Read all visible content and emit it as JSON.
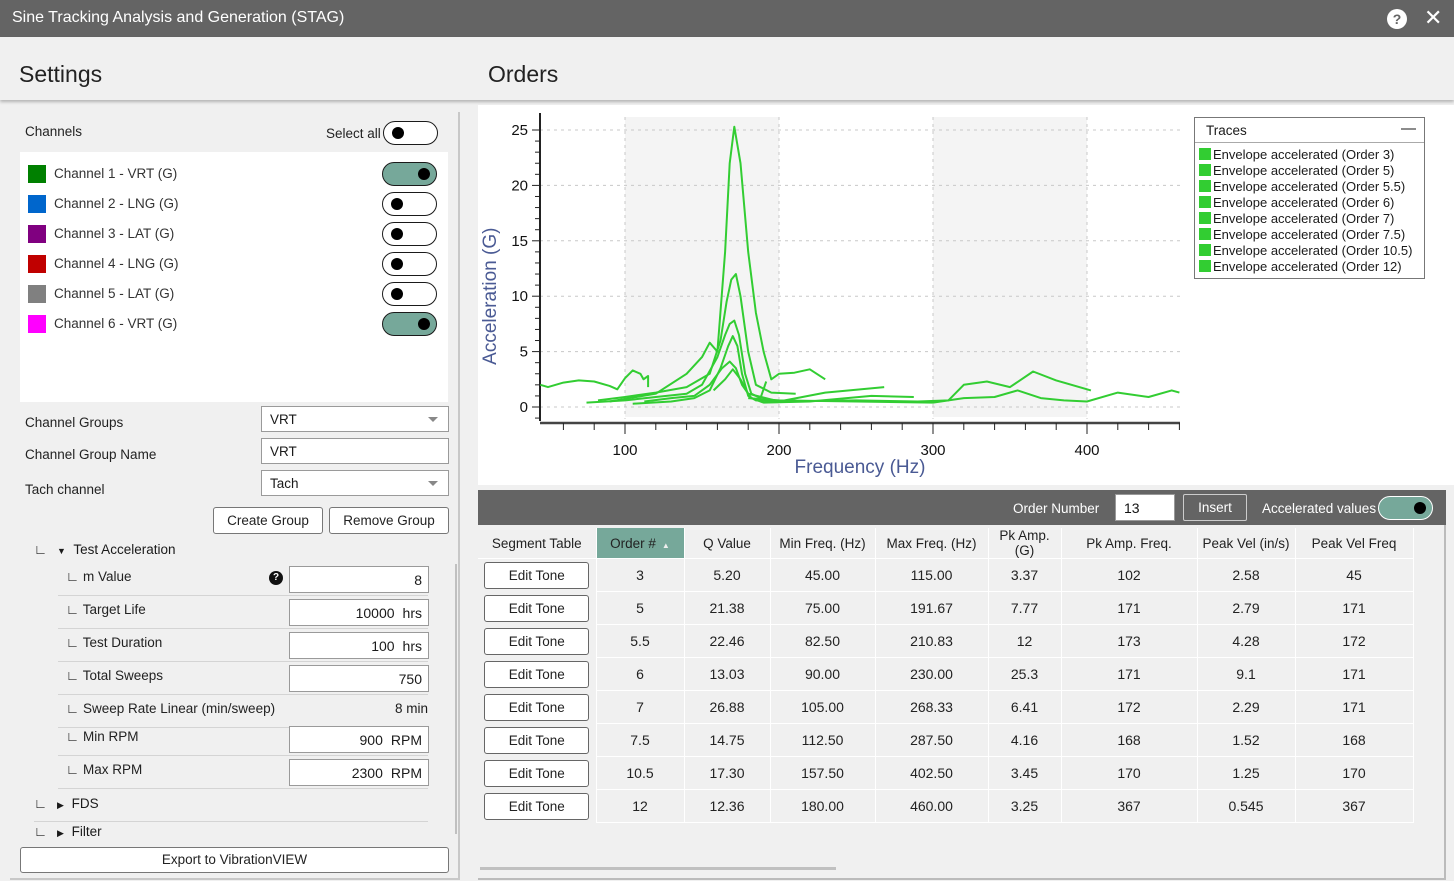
{
  "window": {
    "title": "Sine Tracking Analysis and Generation (STAG)",
    "help_icon": "question-circle-icon",
    "close_icon": "close-icon"
  },
  "headers": {
    "settings": "Settings",
    "orders": "Orders"
  },
  "settings": {
    "channels_label": "Channels",
    "select_all_label": "Select all",
    "select_all_on": false,
    "channels": [
      {
        "label": "Channel 1 - VRT (G)",
        "color": "#008000",
        "on": true
      },
      {
        "label": "Channel 2 - LNG (G)",
        "color": "#0066cc",
        "on": false
      },
      {
        "label": "Channel 3 - LAT (G)",
        "color": "#800080",
        "on": false
      },
      {
        "label": "Channel 4 - LNG (G)",
        "color": "#c00000",
        "on": false
      },
      {
        "label": "Channel 5 - LAT (G)",
        "color": "#808080",
        "on": false
      },
      {
        "label": "Channel 6 - VRT (G)",
        "color": "#ff00ff",
        "on": true
      }
    ],
    "channel_groups_label": "Channel Groups",
    "channel_groups_value": "VRT",
    "channel_group_name_label": "Channel Group Name",
    "channel_group_name_value": "VRT",
    "tach_channel_label": "Tach channel",
    "tach_channel_value": "Tach",
    "create_group": "Create Group",
    "remove_group": "Remove Group",
    "tree_prefix": "∟",
    "test_acceleration": {
      "label": "Test Acceleration",
      "expanded": true,
      "m_value": {
        "label": "m Value",
        "value": "8",
        "unit": ""
      },
      "target_life": {
        "label": "Target Life",
        "value": "10000",
        "unit": "hrs"
      },
      "test_duration": {
        "label": "Test Duration",
        "value": "100",
        "unit": "hrs"
      },
      "total_sweeps": {
        "label": "Total Sweeps",
        "value": "750",
        "unit": ""
      },
      "sweep_rate": {
        "label": "Sweep Rate Linear (min/sweep)",
        "value": "8 min"
      },
      "min_rpm": {
        "label": "Min RPM",
        "value": "900",
        "unit": "RPM"
      },
      "max_rpm": {
        "label": "Max RPM",
        "value": "2300",
        "unit": "RPM"
      }
    },
    "fds_label": "FDS",
    "filter_label": "Filter",
    "export_label": "Export to VibrationVIEW",
    "accent_color": "#76a89a"
  },
  "chart_data": {
    "type": "line",
    "title": "",
    "xlabel": "Frequency (Hz)",
    "ylabel": "Acceleration (G)",
    "xlim": [
      45,
      460
    ],
    "ylim": [
      -1,
      26
    ],
    "xticks": [
      100,
      200,
      300,
      400
    ],
    "yticks": [
      0,
      5,
      10,
      15,
      20,
      25
    ],
    "grid": true,
    "legend_title": "Traces",
    "legend_position": "top-right",
    "series": [
      {
        "name": "Envelope accelerated (Order 3)",
        "color": "#32cd32",
        "x": [
          45,
          50,
          60,
          70,
          80,
          90,
          95,
          100,
          105,
          110,
          112,
          115,
          115
        ],
        "y": [
          2.0,
          1.8,
          2.2,
          2.4,
          2.3,
          1.9,
          1.6,
          2.6,
          3.3,
          3.0,
          2.5,
          2.8,
          1.8
        ]
      },
      {
        "name": "Envelope accelerated (Order 5)",
        "color": "#32cd32",
        "x": [
          75,
          100,
          120,
          140,
          150,
          160,
          165,
          168,
          171,
          174,
          178,
          182,
          188,
          191.67
        ],
        "y": [
          0.4,
          0.6,
          0.9,
          1.2,
          2.0,
          4.5,
          6.5,
          7.5,
          7.8,
          6.5,
          3.0,
          1.2,
          0.8,
          2.3
        ]
      },
      {
        "name": "Envelope accelerated (Order 5.5)",
        "color": "#32cd32",
        "x": [
          82.5,
          100,
          120,
          140,
          155,
          162,
          166,
          169,
          172,
          175,
          180,
          185,
          195,
          210.83
        ],
        "y": [
          0.6,
          0.9,
          1.3,
          1.8,
          3.0,
          6.0,
          9.5,
          11.5,
          12.0,
          10.0,
          5.0,
          2.0,
          1.3,
          1.2
        ]
      },
      {
        "name": "Envelope accelerated (Order 6)",
        "color": "#32cd32",
        "x": [
          90,
          120,
          140,
          150,
          155,
          160,
          165,
          168,
          171,
          175,
          180,
          185,
          190,
          195,
          200,
          210,
          220,
          230
        ],
        "y": [
          0.5,
          1.2,
          3.0,
          4.5,
          5.8,
          5.0,
          14.0,
          22.0,
          25.3,
          22.0,
          14.0,
          8.5,
          5.0,
          2.5,
          3.0,
          3.1,
          3.4,
          2.5
        ]
      },
      {
        "name": "Envelope accelerated (Order 7)",
        "color": "#32cd32",
        "x": [
          105,
          130,
          145,
          155,
          162,
          167,
          170,
          173,
          176,
          180,
          185,
          200,
          230,
          268.33
        ],
        "y": [
          0.3,
          0.5,
          0.8,
          1.5,
          3.5,
          5.5,
          6.4,
          5.5,
          3.0,
          1.0,
          0.6,
          0.5,
          1.3,
          1.8
        ]
      },
      {
        "name": "Envelope accelerated (Order 7.5)",
        "color": "#32cd32",
        "x": [
          112.5,
          130,
          145,
          155,
          163,
          168,
          172,
          176,
          182,
          190,
          220,
          260,
          287.5
        ],
        "y": [
          0.5,
          0.8,
          1.0,
          2.0,
          3.5,
          4.1,
          3.5,
          2.0,
          0.8,
          0.4,
          0.5,
          1.0,
          0.9
        ]
      },
      {
        "name": "Envelope accelerated (Order 10.5)",
        "color": "#32cd32",
        "x": [
          157.5,
          165,
          170,
          175,
          180,
          200,
          250,
          290,
          310,
          320,
          335,
          350,
          365,
          380,
          402.5
        ],
        "y": [
          1.5,
          2.5,
          3.4,
          2.5,
          1.2,
          0.5,
          0.6,
          0.5,
          0.6,
          2.0,
          2.3,
          1.8,
          3.2,
          2.4,
          1.5
        ]
      },
      {
        "name": "Envelope accelerated (Order 12)",
        "color": "#32cd32",
        "x": [
          180,
          200,
          250,
          300,
          320,
          340,
          355,
          370,
          385,
          400,
          420,
          440,
          455,
          460
        ],
        "y": [
          0.8,
          0.6,
          0.5,
          0.4,
          0.8,
          0.9,
          1.5,
          0.8,
          0.6,
          0.5,
          1.3,
          0.9,
          1.5,
          1.3
        ]
      }
    ]
  },
  "table": {
    "toolbar": {
      "order_number_label": "Order Number",
      "order_number_value": "13",
      "insert_label": "Insert",
      "accelerated_label": "Accelerated values",
      "accelerated_on": true
    },
    "columns": [
      "Segment Table",
      "Order #",
      "Q Value",
      "Min Freq. (Hz)",
      "Max Freq. (Hz)",
      "Pk Amp. (G)",
      "Pk Amp. Freq.",
      "Peak Vel (in/s)",
      "Peak Vel Freq"
    ],
    "sorted_column": "Order #",
    "sort_direction": "ascending",
    "edit_label": "Edit Tone",
    "rows": [
      [
        "3",
        "5.20",
        "45.00",
        "115.00",
        "3.37",
        "102",
        "2.58",
        "45"
      ],
      [
        "5",
        "21.38",
        "75.00",
        "191.67",
        "7.77",
        "171",
        "2.79",
        "171"
      ],
      [
        "5.5",
        "22.46",
        "82.50",
        "210.83",
        "12",
        "173",
        "4.28",
        "172"
      ],
      [
        "6",
        "13.03",
        "90.00",
        "230.00",
        "25.3",
        "171",
        "9.1",
        "171"
      ],
      [
        "7",
        "26.88",
        "105.00",
        "268.33",
        "6.41",
        "172",
        "2.29",
        "171"
      ],
      [
        "7.5",
        "14.75",
        "112.50",
        "287.50",
        "4.16",
        "168",
        "1.52",
        "168"
      ],
      [
        "10.5",
        "17.30",
        "157.50",
        "402.50",
        "3.45",
        "170",
        "1.25",
        "170"
      ],
      [
        "12",
        "12.36",
        "180.00",
        "460.00",
        "3.25",
        "367",
        "0.545",
        "367"
      ]
    ]
  }
}
